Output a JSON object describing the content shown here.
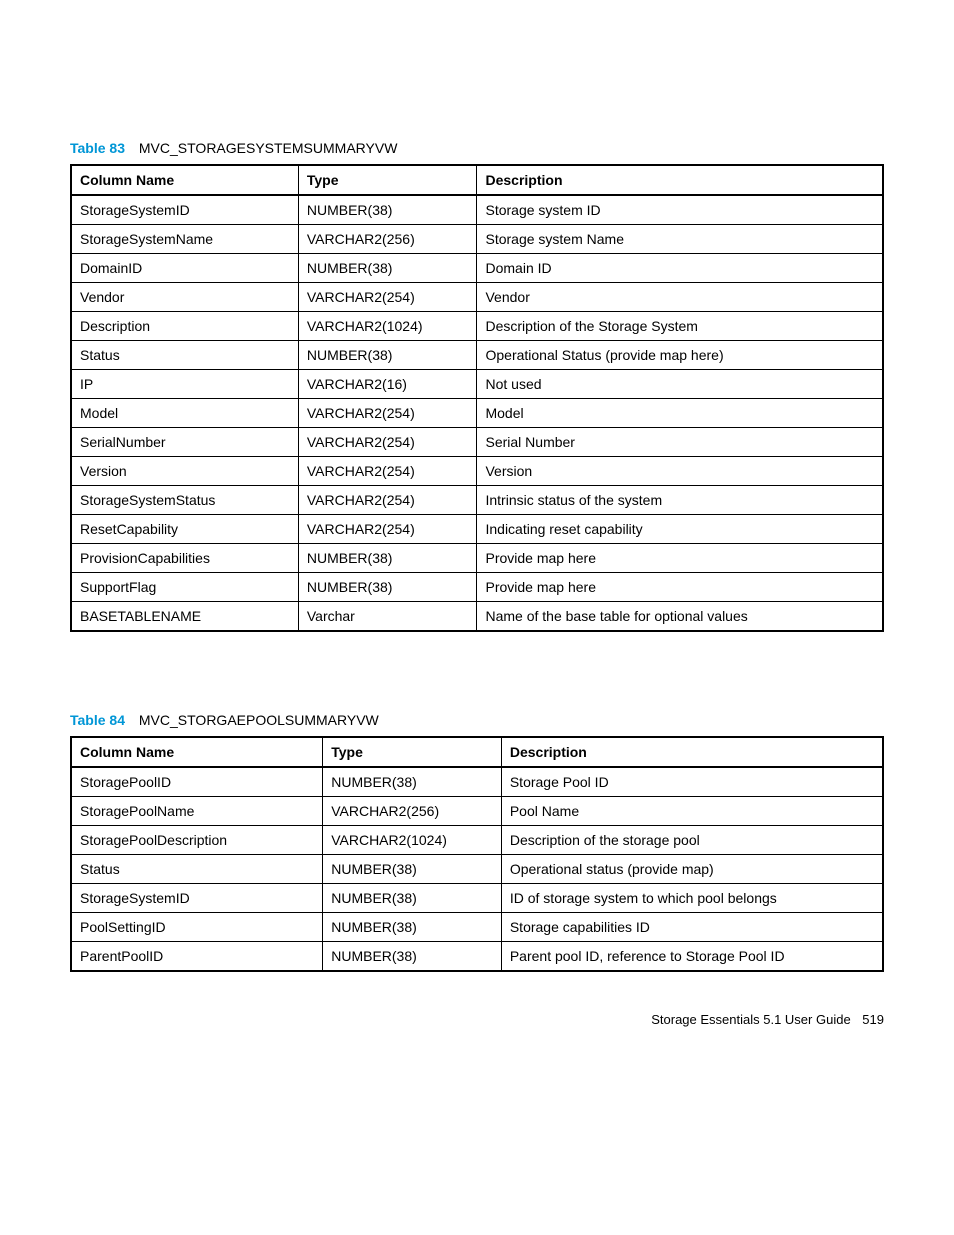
{
  "tables": [
    {
      "number": "Table 83",
      "title": "MVC_STORAGESYSTEMSUMMARYVW",
      "headers": [
        "Column Name",
        "Type",
        "Description"
      ],
      "rows": [
        [
          "StorageSystemID",
          "NUMBER(38)",
          "Storage system ID"
        ],
        [
          "StorageSystemName",
          "VARCHAR2(256)",
          "Storage system Name"
        ],
        [
          "DomainID",
          "NUMBER(38)",
          "Domain ID"
        ],
        [
          "Vendor",
          "VARCHAR2(254)",
          "Vendor"
        ],
        [
          "Description",
          "VARCHAR2(1024)",
          "Description of the Storage System"
        ],
        [
          "Status",
          "NUMBER(38)",
          "Operational Status (provide map here)"
        ],
        [
          "IP",
          "VARCHAR2(16)",
          "Not used"
        ],
        [
          "Model",
          "VARCHAR2(254)",
          "Model"
        ],
        [
          "SerialNumber",
          "VARCHAR2(254)",
          "Serial Number"
        ],
        [
          "Version",
          "VARCHAR2(254)",
          "Version"
        ],
        [
          "StorageSystemStatus",
          "VARCHAR2(254)",
          "Intrinsic status of the system"
        ],
        [
          "ResetCapability",
          "VARCHAR2(254)",
          "Indicating reset capability"
        ],
        [
          "ProvisionCapabilities",
          "NUMBER(38)",
          "Provide map here"
        ],
        [
          "SupportFlag",
          "NUMBER(38)",
          "Provide map here"
        ],
        [
          "BASETABLENAME",
          "Varchar",
          "Name of the base table for optional values"
        ]
      ]
    },
    {
      "number": "Table 84",
      "title": "MVC_STORGAEPOOLSUMMARYVW",
      "headers": [
        "Column Name",
        "Type",
        "Description"
      ],
      "rows": [
        [
          "StoragePoolID",
          "NUMBER(38)",
          "Storage Pool ID"
        ],
        [
          "StoragePoolName",
          "VARCHAR2(256)",
          "Pool Name"
        ],
        [
          "StoragePoolDescription",
          "VARCHAR2(1024)",
          "Description of the storage pool"
        ],
        [
          "Status",
          "NUMBER(38)",
          "Operational status (provide map)"
        ],
        [
          "StorageSystemID",
          "NUMBER(38)",
          "ID of storage system to which pool belongs"
        ],
        [
          "PoolSettingID",
          "NUMBER(38)",
          "Storage capabilities ID"
        ],
        [
          "ParentPoolID",
          "NUMBER(38)",
          "Parent pool ID, reference to Storage Pool ID"
        ]
      ]
    }
  ],
  "footer": {
    "text": "Storage Essentials 5.1 User Guide",
    "page": "519"
  }
}
